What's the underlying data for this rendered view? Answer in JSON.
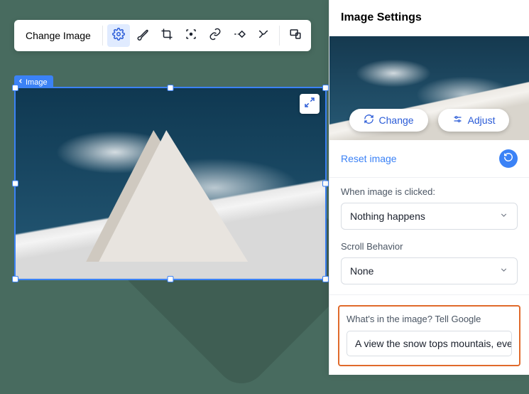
{
  "toolbar": {
    "change_image": "Change Image",
    "icons": {
      "settings": "gear-icon",
      "brush": "brush-icon",
      "crop": "crop-icon",
      "focal": "focal-icon",
      "link": "link-icon",
      "animate": "animate-icon",
      "behaviors": "behaviors-icon",
      "responsive": "responsive-icon"
    }
  },
  "breadcrumb": {
    "label": "Image"
  },
  "panel": {
    "title": "Image Settings",
    "preview": {
      "change": "Change",
      "adjust": "Adjust"
    },
    "reset": "Reset image",
    "click_behavior": {
      "label": "When image is clicked:",
      "value": "Nothing happens"
    },
    "scroll_behavior": {
      "label": "Scroll Behavior",
      "value": "None"
    },
    "alt": {
      "label": "What's in the image? Tell Google",
      "value": "A view the snow tops mountais, ever…"
    }
  }
}
